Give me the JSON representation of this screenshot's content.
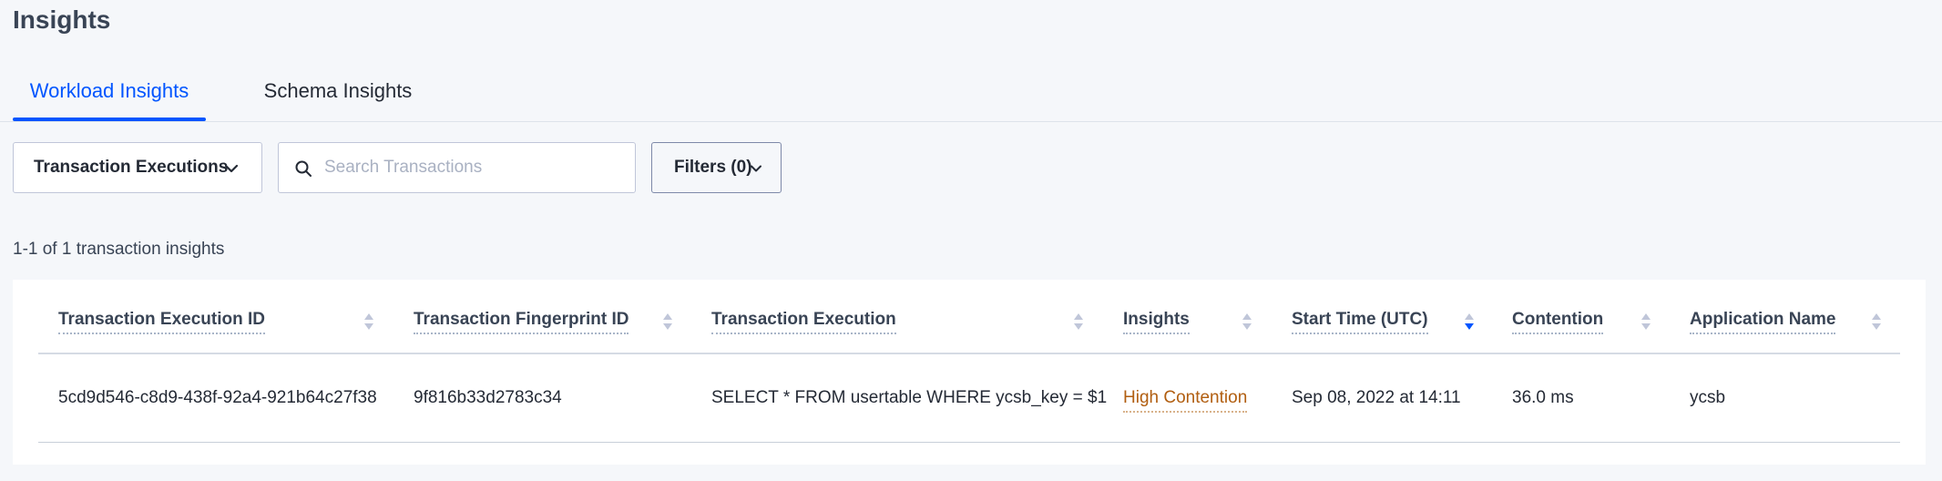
{
  "page": {
    "title": "Insights"
  },
  "tabs": [
    {
      "label": "Workload Insights",
      "active": true
    },
    {
      "label": "Schema Insights",
      "active": false
    }
  ],
  "controls": {
    "view_select": {
      "value": "Transaction Executions",
      "icon": "chevron-down-icon"
    },
    "search": {
      "placeholder": "Search Transactions",
      "value": "",
      "icon": "search-icon"
    },
    "filters": {
      "label": "Filters (0)",
      "icon": "chevron-down-icon"
    }
  },
  "results": {
    "count_text": "1-1 of 1 transaction insights"
  },
  "table": {
    "columns": [
      {
        "label": "Transaction Execution ID",
        "sort": "none"
      },
      {
        "label": "Transaction Fingerprint ID",
        "sort": "none"
      },
      {
        "label": "Transaction Execution",
        "sort": "none"
      },
      {
        "label": "Insights",
        "sort": "none"
      },
      {
        "label": "Start Time (UTC)",
        "sort": "descending"
      },
      {
        "label": "Contention",
        "sort": "none"
      },
      {
        "label": "Application Name",
        "sort": "none"
      }
    ],
    "rows": [
      {
        "execution_id": "5cd9d546-c8d9-438f-92a4-921b64c27f38",
        "fingerprint_id": "9f816b33d2783c34",
        "execution": "SELECT * FROM usertable WHERE ycsb_key = $1",
        "insights": "High Contention",
        "start_time": "Sep 08, 2022 at 14:11",
        "contention": "36.0 ms",
        "application_name": "ycsb"
      }
    ]
  },
  "colors": {
    "accent": "#0055ff",
    "insight_warning": "#b15e10",
    "sort_active": "#0055ff",
    "sort_inactive": "#c0c6d9",
    "background": "#f5f7fa"
  }
}
